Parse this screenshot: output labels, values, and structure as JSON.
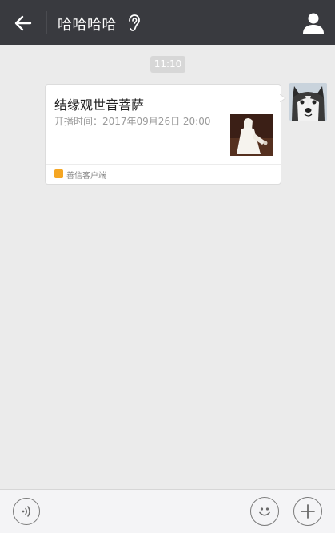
{
  "header": {
    "title": "哈哈哈哈",
    "back_icon": "arrow-left-icon",
    "ear_icon": "ear-icon",
    "profile_icon": "person-icon"
  },
  "chat": {
    "timestamp": "11:10",
    "messages": [
      {
        "type": "link-card",
        "title": "结缘观世音菩萨",
        "subtitle": "开播时间：2017年09月26日  20:00",
        "source": "善信客户端",
        "thumbnail": "guanyin-image",
        "sender_avatar": "husky-avatar"
      }
    ]
  },
  "input_bar": {
    "voice_icon": "voice-icon",
    "emoji_icon": "emoji-icon",
    "plus_icon": "plus-icon",
    "text_value": "",
    "placeholder": ""
  },
  "colors": {
    "topbar": "#393a3f",
    "chat_bg": "#ebebeb",
    "source_badge": "#f5a623"
  }
}
